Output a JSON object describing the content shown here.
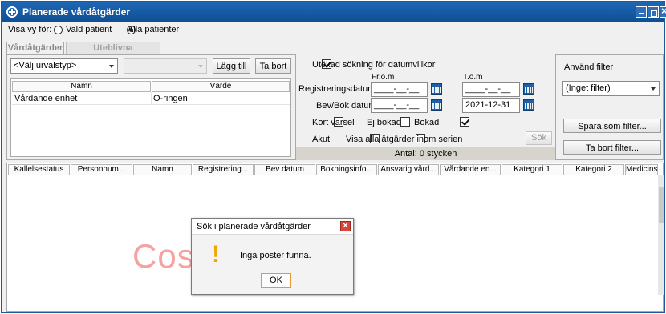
{
  "window": {
    "title": "Planerade vårdåtgärder"
  },
  "view": {
    "label": "Visa vy för:",
    "option_selected_patient": "Vald patient",
    "option_all_patients": "Alla patienter"
  },
  "tabs": [
    {
      "label": "Vårdåtgärder"
    },
    {
      "label": "Uteblivna vårdkontakter"
    }
  ],
  "filter_left": {
    "select_type": "<Välj urvalstyp>",
    "select_value": "",
    "add_button": "Lägg till",
    "remove_button": "Ta bort",
    "table_headers": [
      "Namn",
      "Värde"
    ],
    "rows": [
      {
        "name": "Vårdande enhet",
        "value": "O-ringen"
      }
    ]
  },
  "filter_mid": {
    "extended_search_label": "Utökad sökning för datumvillkor",
    "from_label": "Fr.o.m",
    "to_label": "T.o.m",
    "reg_date_label": "Registreringsdatum",
    "reg_from": "____-__-__",
    "reg_to": "____-__-__",
    "booking_date_label": "Bev/Bok datum",
    "booking_from": "____-__-__",
    "booking_to": "2021-12-31",
    "cb_short_notice": "Kort varsel",
    "cb_not_booked": "Ej bokad",
    "cb_booked": "Bokad",
    "cb_acute": "Akut",
    "cb_show_all": "Visa alla åtgärder inom serien",
    "search_button": "Sök",
    "count_label": "Antal: 0 stycken"
  },
  "filter_right": {
    "use_filter_label": "Använd filter",
    "filter_select": "(Inget filter)",
    "save_filter_button": "Spara som filter...",
    "remove_filter_button": "Ta bort filter..."
  },
  "results": {
    "columns": [
      "Kallelsestatus",
      "Personnum...",
      "Namn",
      "Registrering...",
      "Bev datum",
      "Bokningsinfo...",
      "Ansvarig vård...",
      "Vårdande en...",
      "Kategori 1",
      "Kategori 2",
      "Medicins"
    ]
  },
  "watermark": "Cosmic test",
  "dialog": {
    "title": "Sök i planerade vårdåtgärder",
    "icon": "!",
    "message": "Inga poster funna.",
    "ok_button": "OK"
  }
}
